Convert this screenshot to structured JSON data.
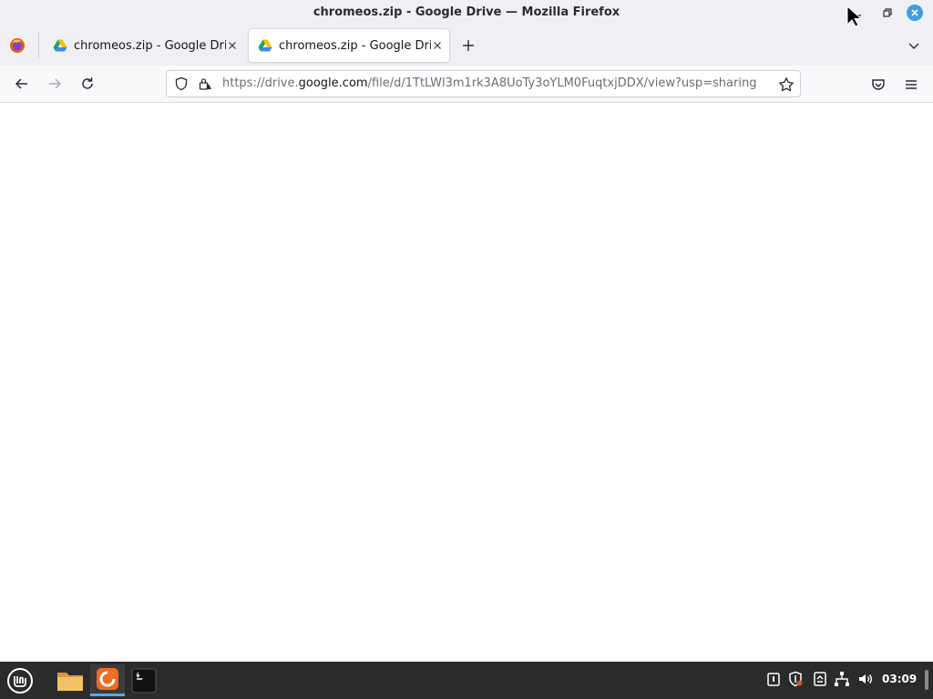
{
  "window": {
    "title": "chromeos.zip - Google Drive — Mozilla Firefox"
  },
  "tabs": [
    {
      "label": "chromeos.zip - Google Drive",
      "active": false,
      "favicon": "google-drive-icon"
    },
    {
      "label": "chromeos.zip - Google Drive",
      "active": true,
      "favicon": "google-drive-icon"
    }
  ],
  "urlbar": {
    "scheme_prefix": "https://drive.",
    "host": "google.com",
    "path": "/file/d/1TtLWl3m1rk3A8UoTy3oYLM0FuqtxjDDX/view?usp=sharing"
  },
  "taskbar": {
    "clock": "03:09",
    "apps": [
      "menu-icon",
      "files-icon",
      "firefox-icon",
      "terminal-icon"
    ],
    "tray": [
      "clipboard-icon",
      "shield-update-icon",
      "removable-drive-icon",
      "network-icon",
      "volume-icon"
    ]
  },
  "colors": {
    "accent": "#3d9fe0",
    "taskbar": "#2b2b2b",
    "chrome": "#f0f0f4"
  }
}
